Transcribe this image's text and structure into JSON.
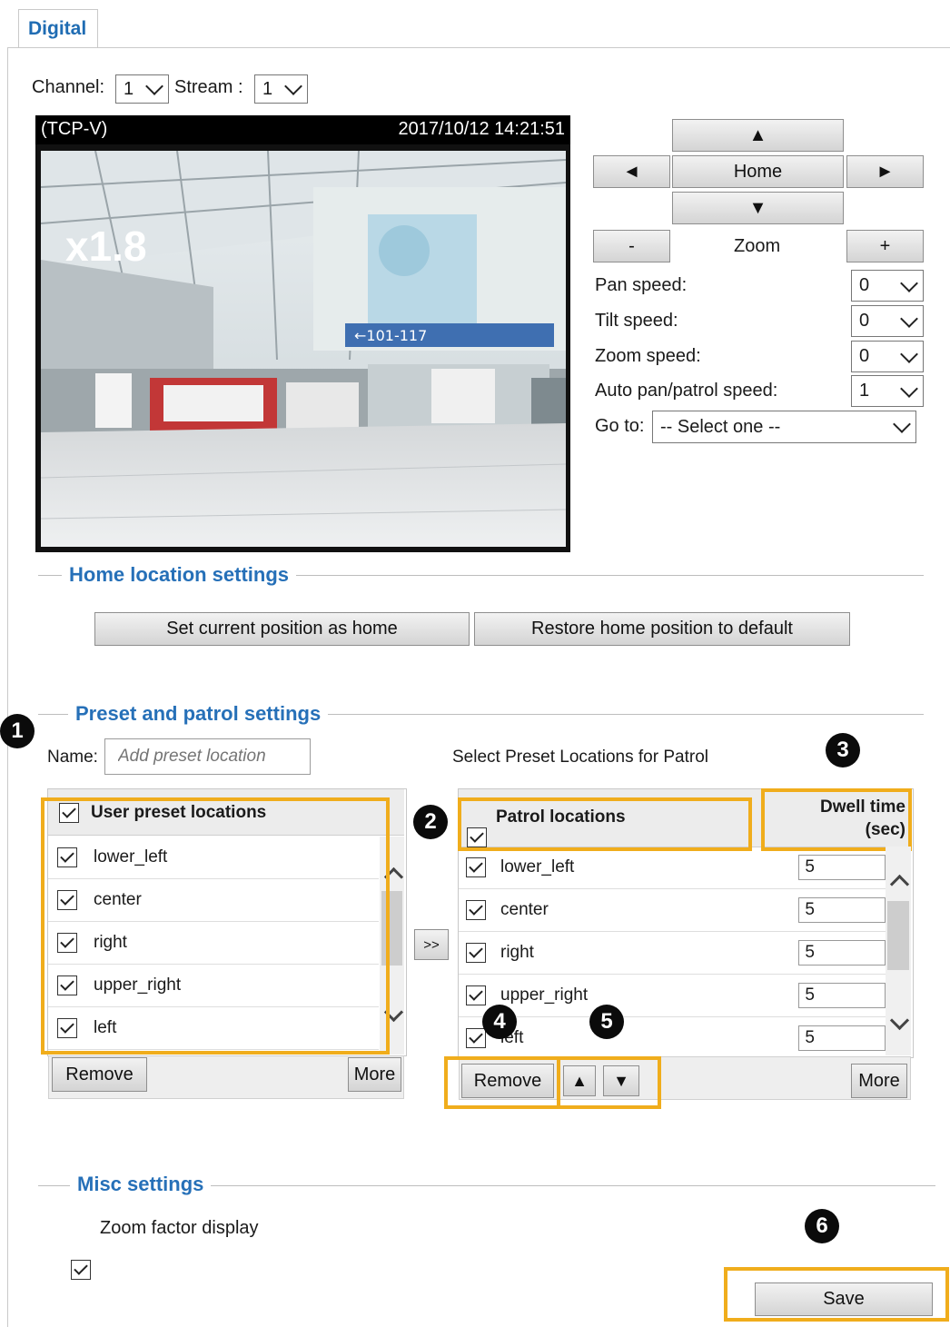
{
  "tab": {
    "label": "Digital"
  },
  "header": {
    "channel_label": "Channel:",
    "channel_value": "1",
    "stream_label": "Stream :",
    "stream_value": "1"
  },
  "video": {
    "protocol": "(TCP-V)",
    "timestamp": "2017/10/12 14:21:51",
    "zoom_overlay": "x1.8"
  },
  "ptz": {
    "up_glyph": "▲",
    "down_glyph": "▼",
    "left_glyph": "◄",
    "right_glyph": "►",
    "home_label": "Home",
    "zoom_out_label": "-",
    "zoom_label": "Zoom",
    "zoom_in_label": "+",
    "pan_speed_label": "Pan speed:",
    "pan_speed_value": "0",
    "tilt_speed_label": "Tilt speed:",
    "tilt_speed_value": "0",
    "zoom_speed_label": "Zoom speed:",
    "zoom_speed_value": "0",
    "auto_speed_label": "Auto pan/patrol speed:",
    "auto_speed_value": "1",
    "goto_label": "Go to:",
    "goto_value": "-- Select one --"
  },
  "home_section": {
    "title": "Home location settings",
    "set_home_label": "Set current position as home",
    "restore_label": "Restore home position to default"
  },
  "preset_section": {
    "title": "Preset and patrol settings",
    "name_label": "Name:",
    "name_placeholder": "Add preset location",
    "patrol_caption": "Select Preset Locations for Patrol",
    "user_header": "User preset locations",
    "user_items": [
      "lower_left",
      "center",
      "right",
      "upper_right",
      "left"
    ],
    "add_label": ">>",
    "remove_label": "Remove",
    "more_label": "More",
    "patrol_header": "Patrol locations",
    "dwell_header_line1": "Dwell time",
    "dwell_header_line2": "(sec)",
    "patrol_items": [
      {
        "name": "lower_left",
        "dwell": "5"
      },
      {
        "name": "center",
        "dwell": "5"
      },
      {
        "name": "right",
        "dwell": "5"
      },
      {
        "name": "upper_right",
        "dwell": "5"
      },
      {
        "name": "left",
        "dwell": "5"
      }
    ],
    "patrol_remove_label": "Remove",
    "move_up_glyph": "▲",
    "move_down_glyph": "▼",
    "patrol_more_label": "More"
  },
  "misc_section": {
    "title": "Misc settings",
    "zoom_display_label": "Zoom factor display"
  },
  "save_label": "Save",
  "callouts": [
    "1",
    "2",
    "3",
    "4",
    "5",
    "6"
  ],
  "colors": {
    "accent": "#2670b8",
    "highlight": "#f0ad1c"
  }
}
